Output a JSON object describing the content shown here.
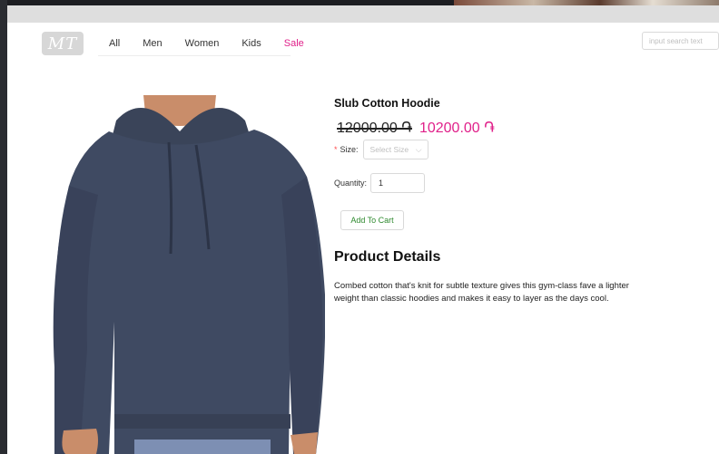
{
  "header": {
    "logo_text": "MT",
    "nav": [
      "All",
      "Men",
      "Women",
      "Kids",
      "Sale"
    ],
    "search_placeholder": "input search text"
  },
  "product": {
    "title": "Slub Cotton Hoodie",
    "old_price": "12000.00 ֏",
    "new_price": "10200.00 ֏",
    "size_label": "Size",
    "size_placeholder": "Select Size",
    "quantity_label": "Quantity",
    "quantity_value": "1",
    "add_to_cart": "Add To Cart",
    "details_heading": "Product Details",
    "description": "Combed cotton that's knit for subtle texture gives this gym-class fave a lighter weight than classic hoodies and makes it easy to layer as the days cool."
  },
  "colors": {
    "accent": "#e0218a",
    "hoodie": "#3f4a62",
    "skin": "#c98d6a"
  }
}
